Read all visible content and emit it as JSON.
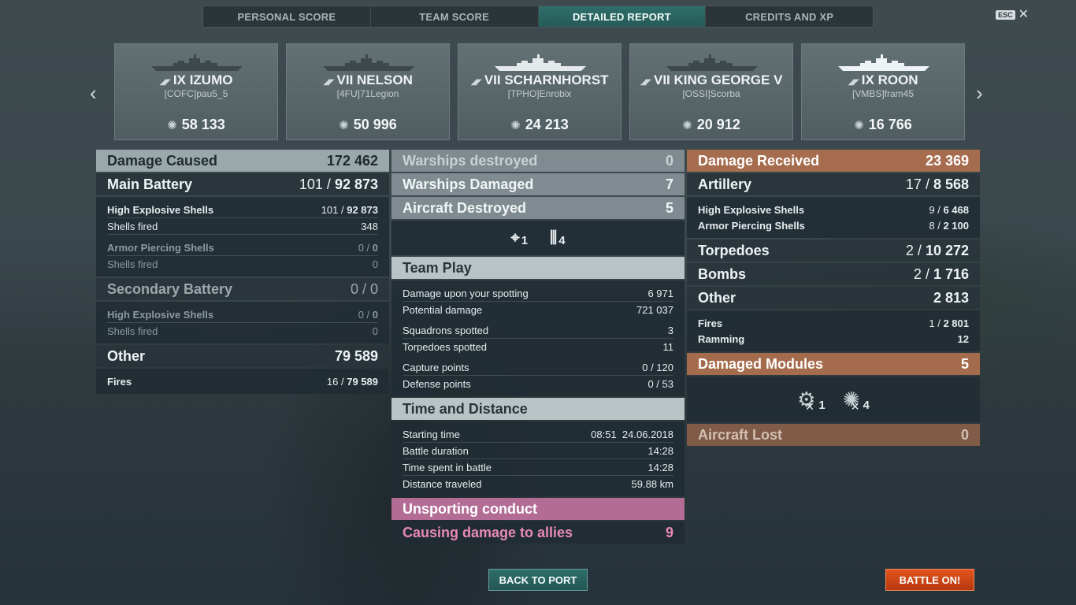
{
  "tabs": [
    "PERSONAL SCORE",
    "TEAM SCORE",
    "DETAILED REPORT",
    "CREDITS AND XP"
  ],
  "esc": {
    "key": "ESC",
    "close": "✕"
  },
  "ships": [
    {
      "flag": "◢◤",
      "name": "IX IZUMO",
      "player": "[COFC]pau5_5",
      "damage": "58 133",
      "shipColor": "#3c484c"
    },
    {
      "flag": "◢◤",
      "name": "VII NELSON",
      "player": "[4FU]71Legion",
      "damage": "50 996",
      "shipColor": "#3c484c"
    },
    {
      "flag": "◢◤",
      "name": "VII SCHARNHORST",
      "player": "[TPHO]Enrobix",
      "damage": "24 213",
      "shipColor": "#e4eaec"
    },
    {
      "flag": "◢◤",
      "name": "VII KING GEORGE V",
      "player": "[OSSI]Scorba",
      "damage": "20 912",
      "shipColor": "#3c484c"
    },
    {
      "flag": "◢◤",
      "name": "IX ROON",
      "player": "[VMBS]fram45",
      "damage": "16 766",
      "shipColor": "#eef3f6"
    }
  ],
  "col1": {
    "damage_caused": {
      "label": "Damage Caused",
      "value": "172 462"
    },
    "main_battery": {
      "label": "Main Battery",
      "hits": "101",
      "sep": " / ",
      "dmg": "92 873"
    },
    "main_rows": [
      {
        "label": "High Explosive Shells",
        "hits": "101",
        "dmg": "92 873"
      },
      {
        "label": "Shells fired",
        "value": "348"
      },
      {
        "label": "Armor Piercing Shells",
        "hits": "0",
        "dmg": "0"
      },
      {
        "label": "Shells fired",
        "value": "0"
      }
    ],
    "secondary": {
      "label": "Secondary Battery",
      "value": "0 / 0"
    },
    "secondary_rows": [
      {
        "label": "High Explosive Shells",
        "hits": "0",
        "dmg": "0"
      },
      {
        "label": "Shells fired",
        "value": "0"
      }
    ],
    "other": {
      "label": "Other",
      "value": "79 589"
    },
    "other_rows": [
      {
        "label": "Fires",
        "hits": "16",
        "dmg": "79 589"
      }
    ]
  },
  "col2": {
    "warships_destroyed": {
      "label": "Warships destroyed",
      "value": "0"
    },
    "warships_damaged": {
      "label": "Warships Damaged",
      "value": "7"
    },
    "aircraft_destroyed": {
      "label": "Aircraft Destroyed",
      "value": "5"
    },
    "aircraft_icons": [
      {
        "icon": "⌖",
        "value": "1"
      },
      {
        "icon": "⫼",
        "value": "4"
      }
    ],
    "team_play": {
      "label": "Team Play"
    },
    "team_rows": [
      {
        "label": "Damage upon your spotting",
        "value": "6 971"
      },
      {
        "label": "Potential damage",
        "value": "721 037"
      },
      {
        "label": "Squadrons spotted",
        "value": "3"
      },
      {
        "label": "Torpedoes spotted",
        "value": "11"
      },
      {
        "label": "Capture points",
        "value": "0 / 120"
      },
      {
        "label": "Defense points",
        "value": "0 / 53"
      }
    ],
    "time_distance": {
      "label": "Time and Distance"
    },
    "time_rows": [
      {
        "label": "Starting time",
        "value": "08:51  24.06.2018"
      },
      {
        "label": "Battle duration",
        "value": "14:28"
      },
      {
        "label": "Time spent in battle",
        "value": "14:28"
      },
      {
        "label": "Distance traveled",
        "value": "59.88 km"
      }
    ],
    "unsporting": {
      "label": "Unsporting conduct"
    },
    "ally_damage": {
      "label": "Causing damage to allies",
      "value": "9"
    }
  },
  "col3": {
    "damage_received": {
      "label": "Damage Received",
      "value": "23 369"
    },
    "artillery": {
      "label": "Artillery",
      "hits": "17",
      "dmg": "8 568"
    },
    "artillery_rows": [
      {
        "label": "High Explosive Shells",
        "hits": "9",
        "dmg": "6 468"
      },
      {
        "label": "Armor Piercing Shells",
        "hits": "8",
        "dmg": "2 100"
      }
    ],
    "torpedoes": {
      "label": "Torpedoes",
      "hits": "2",
      "dmg": "10 272"
    },
    "bombs": {
      "label": "Bombs",
      "hits": "2",
      "dmg": "1 716"
    },
    "other": {
      "label": "Other",
      "value": "2 813"
    },
    "other_rows": [
      {
        "label": "Fires",
        "hits": "1",
        "dmg": "2 801"
      },
      {
        "label": "Ramming",
        "value": "12"
      }
    ],
    "damaged_modules": {
      "label": "Damaged Modules",
      "value": "5"
    },
    "modules": [
      {
        "icon": "⚙",
        "value": "1"
      },
      {
        "icon": "✺",
        "value": "4"
      }
    ],
    "aircraft_lost": {
      "label": "Aircraft Lost",
      "value": "0"
    }
  },
  "buttons": {
    "back": "BACK TO PORT",
    "battle": "BATTLE ON!"
  }
}
